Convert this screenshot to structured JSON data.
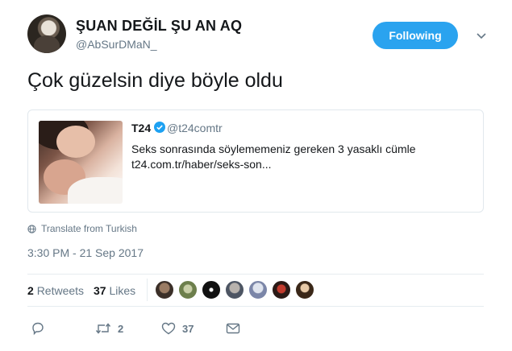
{
  "author": {
    "display_name": "ŞUAN DEĞİL ŞU AN AQ",
    "handle": "@AbSurDMaN_",
    "follow_label": "Following"
  },
  "tweet": {
    "text": "Çok güzelsin diye böyle oldu"
  },
  "quote": {
    "name": "T24",
    "handle": "@t24comtr",
    "text": "Seks sonrasında söylememeniz gereken 3 yasaklı cümle",
    "link": "t24.com.tr/haber/seks-son..."
  },
  "translate_label": "Translate from Turkish",
  "timestamp": "3:30 PM - 21 Sep 2017",
  "stats": {
    "retweets_count": "2",
    "retweets_label": "Retweets",
    "likes_count": "37",
    "likes_label": "Likes"
  },
  "actions": {
    "reply_icon": "reply-icon",
    "retweet_icon": "retweet-icon",
    "retweet_count": "2",
    "like_icon": "heart-icon",
    "like_count": "37",
    "dm_icon": "envelope-icon"
  },
  "colors": {
    "accent": "#2aa3ef",
    "verified": "#1da1f2",
    "secondary_text": "#657786"
  }
}
